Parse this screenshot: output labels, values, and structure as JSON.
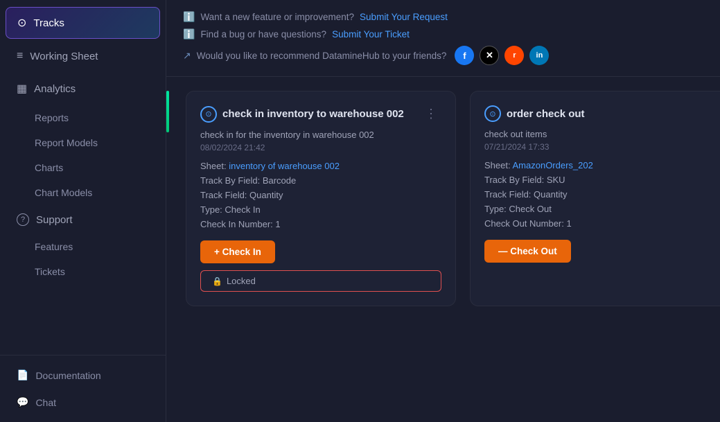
{
  "sidebar": {
    "items": [
      {
        "id": "tracks",
        "label": "Tracks",
        "icon": "⊙",
        "active": true
      },
      {
        "id": "working-sheet",
        "label": "Working Sheet",
        "icon": "≡",
        "active": false
      },
      {
        "id": "analytics",
        "label": "Analytics",
        "icon": "▦",
        "active": false
      }
    ],
    "sub_items": [
      {
        "id": "reports",
        "label": "Reports"
      },
      {
        "id": "report-models",
        "label": "Report Models"
      },
      {
        "id": "charts",
        "label": "Charts"
      },
      {
        "id": "chart-models",
        "label": "Chart Models"
      }
    ],
    "support": {
      "label": "Support",
      "icon": "?",
      "items": [
        {
          "id": "features",
          "label": "Features"
        },
        {
          "id": "tickets",
          "label": "Tickets"
        }
      ]
    },
    "bottom_items": [
      {
        "id": "documentation",
        "label": "Documentation",
        "icon": "📄"
      },
      {
        "id": "chat",
        "label": "Chat",
        "icon": "💬"
      }
    ]
  },
  "top_info": {
    "rows": [
      {
        "icon": "ℹ",
        "text": "Want a new feature or improvement?",
        "link_text": "Submit Your Request",
        "link_href": "#"
      },
      {
        "icon": "ℹ",
        "text": "Find a bug or have questions?",
        "link_text": "Submit Your Ticket",
        "link_href": "#"
      },
      {
        "icon": "↗",
        "text": "Would you like to recommend DatamineHub to your friends?",
        "socials": [
          "f",
          "𝕏",
          "r",
          "in"
        ]
      }
    ]
  },
  "cards": [
    {
      "id": "card-1",
      "icon": "⊙",
      "title": "check in inventory to warehouse 002",
      "description": "check in for the inventory in warehouse 002",
      "date": "08/02/2024 21:42",
      "sheet_label": "Sheet:",
      "sheet_link": "inventory of warehouse 002",
      "track_by_field": "Track By Field: Barcode",
      "track_field": "Track Field: Quantity",
      "type": "Type: Check In",
      "number_label": "Check In Number: 1",
      "button_label": "+ Check In",
      "locked_label": "🔒 Locked",
      "has_locked": true
    },
    {
      "id": "card-2",
      "icon": "⊙",
      "title": "order check out",
      "description": "check out items",
      "date": "07/21/2024 17:33",
      "sheet_label": "Sheet:",
      "sheet_link": "AmazonOrders_202",
      "track_by_field": "Track By Field: SKU",
      "track_field": "Track Field: Quantity",
      "type": "Type: Check Out",
      "number_label": "Check Out Number: 1",
      "button_label": "— Check Out",
      "has_locked": false
    }
  ]
}
